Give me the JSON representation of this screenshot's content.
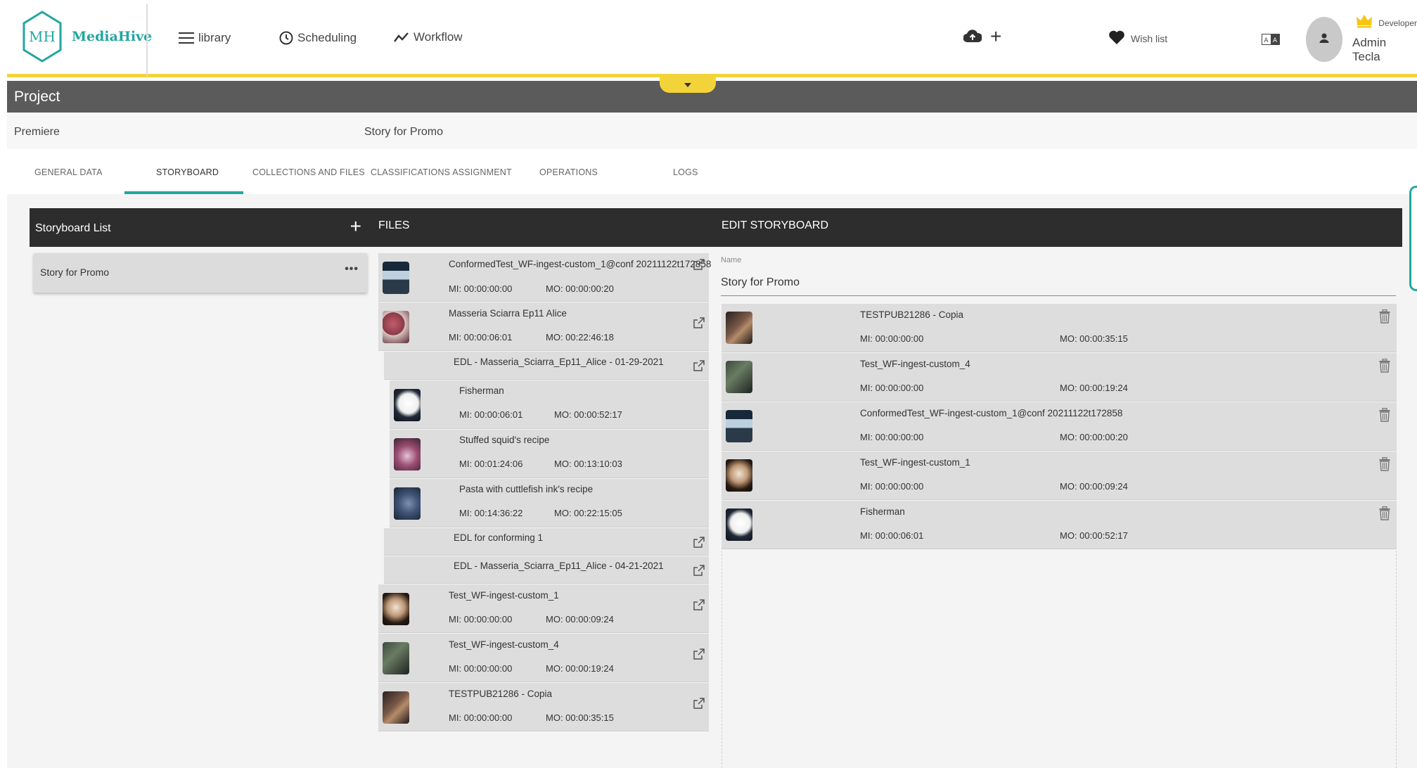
{
  "app": {
    "logo_text": "MediaHive",
    "logo_mark": "MH"
  },
  "nav": {
    "library": "library",
    "scheduling": "Scheduling",
    "workflow": "Workflow",
    "wish_list": "Wish list"
  },
  "user": {
    "role": "Developer",
    "name": "Admin Tecla"
  },
  "project": {
    "title": "Project",
    "type": "Premiere",
    "name": "Story for Promo"
  },
  "tabs": [
    {
      "label": "GENERAL DATA",
      "active": false
    },
    {
      "label": "STORYBOARD",
      "active": true
    },
    {
      "label": "COLLECTIONS AND FILES",
      "active": false
    },
    {
      "label": "CLASSIFICATIONS ASSIGNMENT",
      "active": false
    },
    {
      "label": "OPERATIONS",
      "active": false
    },
    {
      "label": "LOGS",
      "active": false
    }
  ],
  "storyboard_list": {
    "header": "Storyboard List",
    "items": [
      {
        "name": "Story for Promo",
        "menu": "•••"
      }
    ]
  },
  "files": {
    "header": "FILES",
    "rows": [
      {
        "title": "ConformedTest_WF-ingest-custom_1@conf 20211122t172858",
        "mi": "MI: 00:00:00:00",
        "mo": "MO: 00:00:00:20",
        "thumb": "beach"
      },
      {
        "title": "Masseria Sciarra Ep11 Alice",
        "mi": "MI: 00:00:06:01",
        "mo": "MO: 00:22:46:18",
        "thumb": "food"
      },
      {
        "title": "EDL - Masseria_Sciarra_Ep11_Alice - 01-29-2021"
      },
      {
        "title": "Fisherman",
        "mi": "MI: 00:00:06:01",
        "mo": "MO: 00:00:52:17",
        "thumb": "moon"
      },
      {
        "title": "Stuffed squid's recipe",
        "mi": "MI: 00:01:24:06",
        "mo": "MO: 00:13:10:03",
        "thumb": "squid"
      },
      {
        "title": "Pasta with cuttlefish ink's recipe",
        "mi": "MI: 00:14:36:22",
        "mo": "MO: 00:22:15:05",
        "thumb": "pasta"
      },
      {
        "title": "EDL for conforming 1"
      },
      {
        "title": "EDL - Masseria_Sciarra_Ep11_Alice - 04-21-2021"
      },
      {
        "title": "Test_WF-ingest-custom_1",
        "mi": "MI: 00:00:00:00",
        "mo": "MO: 00:00:09:24",
        "thumb": "face"
      },
      {
        "title": "Test_WF-ingest-custom_4",
        "mi": "MI: 00:00:00:00",
        "mo": "MO: 00:00:19:24",
        "thumb": "cook"
      },
      {
        "title": "TESTPUB21286 - Copia",
        "mi": "MI: 00:00:00:00",
        "mo": "MO: 00:00:35:15",
        "thumb": "copia"
      }
    ]
  },
  "edit_storyboard": {
    "header": "EDIT STORYBOARD",
    "name_label": "Name",
    "name_value": "Story for Promo",
    "rows": [
      {
        "title": "TESTPUB21286 - Copia",
        "mi": "MI: 00:00:00:00",
        "mo": "MO: 00:00:35:15",
        "thumb": "copia"
      },
      {
        "title": "Test_WF-ingest-custom_4",
        "mi": "MI: 00:00:00:00",
        "mo": "MO: 00:00:19:24",
        "thumb": "cook"
      },
      {
        "title": "ConformedTest_WF-ingest-custom_1@conf 20211122t172858",
        "mi": "MI: 00:00:00:00",
        "mo": "MO: 00:00:00:20",
        "thumb": "beach"
      },
      {
        "title": "Test_WF-ingest-custom_1",
        "mi": "MI: 00:00:00:00",
        "mo": "MO: 00:00:09:24",
        "thumb": "face"
      },
      {
        "title": "Fisherman",
        "mi": "MI: 00:00:06:01",
        "mo": "MO: 00:00:52:17",
        "thumb": "moon"
      }
    ]
  },
  "colors": {
    "accent_teal": "#1fa8a1",
    "accent_yellow": "#f2d43a",
    "dark_bar": "#2d2d2d",
    "project_bar": "#5b5b5b"
  },
  "icons": [
    "menu-icon",
    "clock-icon",
    "workflow-icon",
    "upload-icon",
    "plus-icon",
    "heart-icon",
    "language-icon",
    "user-icon",
    "crown-icon",
    "chevron-down-icon",
    "external-link-icon",
    "trash-icon"
  ]
}
